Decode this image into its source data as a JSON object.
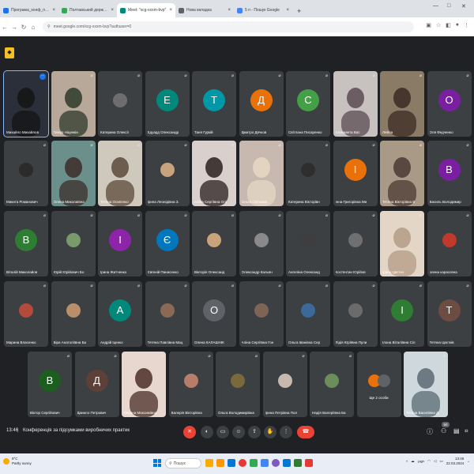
{
  "browser": {
    "tabs": [
      {
        "label": "Програма_конф_практ_2024.d",
        "fav": "#1a73e8",
        "active": false
      },
      {
        "label": "Полтавський державний агр",
        "fav": "#34a853",
        "active": false
      },
      {
        "label": "Meet: \"xcg-xxxm-bvp\"",
        "fav": "#00897b",
        "active": true
      },
      {
        "label": "Нова вкладка",
        "fav": "#5f6368",
        "active": false
      },
      {
        "label": "5 п - Пошук Google",
        "fav": "#4285f4",
        "active": false
      }
    ],
    "new_tab": "+",
    "url": "meet.google.com/xcg-xxxm-bvp?authuser=0"
  },
  "meet": {
    "participants": [
      {
        "name": "Михайло Михайлов",
        "kind": "video",
        "bg": "#2a2f3a",
        "fg": "#141414"
      },
      {
        "name": "Тимур Ніценкін",
        "kind": "video",
        "bg": "#b7a89a",
        "fg": "#2e3a2c"
      },
      {
        "name": "Катерина Олексії",
        "kind": "photo",
        "bg": "#3c4043",
        "fg": "#6d6d6d"
      },
      {
        "name": "Едуард Олександр",
        "kind": "letter",
        "letter": "Е",
        "color": "#00897b"
      },
      {
        "name": "Таня Гуркій",
        "kind": "letter",
        "letter": "Т",
        "color": "#0097a7"
      },
      {
        "name": "Дмитро Дячков",
        "kind": "letter",
        "letter": "Д",
        "color": "#e8710a"
      },
      {
        "name": "Світлана Писаренко",
        "kind": "letter",
        "letter": "С",
        "color": "#43a047"
      },
      {
        "name": "Єлизавета Вас",
        "kind": "video",
        "bg": "#c7c2c0",
        "fg": "#5a4b52"
      },
      {
        "name": "Лейла",
        "kind": "video",
        "bg": "#8a7b66",
        "fg": "#3a2a24"
      },
      {
        "name": "Оля Федченко",
        "kind": "letter",
        "letter": "О",
        "color": "#7b1fa2"
      },
      {
        "name": "Микита Романович",
        "kind": "photo",
        "bg": "#3c4043",
        "fg": "#2b2b2b"
      },
      {
        "name": "Олена Миколаївна",
        "kind": "video",
        "bg": "#6b8f8a",
        "fg": "#3b2d29"
      },
      {
        "name": "Тетяна Осипенко",
        "kind": "video",
        "bg": "#cfc8bd",
        "fg": "#5c4a3b"
      },
      {
        "name": "Ірина Леонідівна З.",
        "kind": "photo",
        "bg": "#3c4043",
        "fg": "#c9a27e"
      },
      {
        "name": "Аліна Сергіївна Олі",
        "kind": "video",
        "bg": "#d9d0cd",
        "fg": "#2a1f1f"
      },
      {
        "name": "Ольга Світлана",
        "kind": "video",
        "bg": "#c8b9b0",
        "fg": "#e6d8c4"
      },
      {
        "name": "Катерина Вікторівн",
        "kind": "photo",
        "bg": "#3c4043",
        "fg": "#2e2e2e"
      },
      {
        "name": "Інна Григорівна Ми",
        "kind": "letter",
        "letter": "І",
        "color": "#e8710a"
      },
      {
        "name": "Тетяна Вікторівна В",
        "kind": "video",
        "bg": "#a89a86",
        "fg": "#4b3a33"
      },
      {
        "name": "Василь Володимир",
        "kind": "letter",
        "letter": "В",
        "color": "#7b1fa2"
      },
      {
        "name": "Віталій Миколайов",
        "kind": "letter",
        "letter": "В",
        "color": "#2e7d32"
      },
      {
        "name": "Юрій Юрійович Бо",
        "kind": "photo",
        "bg": "#3c4043",
        "fg": "#7a9a6b"
      },
      {
        "name": "Ірина Житченко",
        "kind": "letter",
        "letter": "І",
        "color": "#8e24aa"
      },
      {
        "name": "Євгеній Панасенко",
        "kind": "letter",
        "letter": "Є",
        "color": "#0277bd"
      },
      {
        "name": "Вікторія Олександ",
        "kind": "photo",
        "bg": "#3c4043",
        "fg": "#caa27b"
      },
      {
        "name": "Олександр Кальян",
        "kind": "photo",
        "bg": "#3c4043",
        "fg": "#8a8a8a"
      },
      {
        "name": "Ангеліна Олександ",
        "kind": "photo",
        "bg": "#3c4043",
        "fg": "#3e3e3e"
      },
      {
        "name": "Костянтин Юрійов",
        "kind": "photo",
        "bg": "#3c4043",
        "fg": "#6f6f6f"
      },
      {
        "name": "Ірина Цвєтко",
        "kind": "video",
        "bg": "#e3d6c6",
        "fg": "#b49b86"
      },
      {
        "name": "олена карасєвна",
        "kind": "photo",
        "bg": "#3c4043",
        "fg": "#c0392b"
      },
      {
        "name": "Марина Власенко",
        "kind": "photo",
        "bg": "#3c4043",
        "fg": "#b34a3c"
      },
      {
        "name": "Віра Анатоліївна Ба",
        "kind": "photo",
        "bg": "#3c4043",
        "fg": "#b88e6b"
      },
      {
        "name": "Андрій Іценко",
        "kind": "letter",
        "letter": "А",
        "color": "#00897b"
      },
      {
        "name": "Тетяна Павлівна Мац",
        "kind": "photo",
        "bg": "#3c4043",
        "fg": "#8b6a55"
      },
      {
        "name": "Олена КАЛАШНІК",
        "kind": "letter",
        "letter": "О",
        "color": "#5f6368"
      },
      {
        "name": "Аліна Сергіївна Гон",
        "kind": "photo",
        "bg": "#3c4043",
        "fg": "#7d6457"
      },
      {
        "name": "Ольга Іванівна Сер",
        "kind": "photo",
        "bg": "#3c4043",
        "fg": "#3b6a9a"
      },
      {
        "name": "Лідія Юріївна Пули",
        "kind": "photo",
        "bg": "#3c4043",
        "fg": "#6b6b6b"
      },
      {
        "name": "Ілона Віталіївна Сіл",
        "kind": "letter",
        "letter": "І",
        "color": "#2e7d32"
      },
      {
        "name": "Тетяна Цвєтків",
        "kind": "letter",
        "letter": "Т",
        "color": "#6d4c41"
      },
      {
        "name": "Віктор Сергійович",
        "kind": "letter",
        "letter": "В",
        "color": "#1b5e20"
      },
      {
        "name": "Данило Петрович",
        "kind": "letter",
        "letter": "Д",
        "color": "#5d4037"
      },
      {
        "name": "Оксана Максимівна",
        "kind": "video",
        "bg": "#e8d7cf",
        "fg": "#4a2f28"
      },
      {
        "name": "Валерія Вікторівна",
        "kind": "photo",
        "bg": "#3c4043",
        "fg": "#b87c6a"
      },
      {
        "name": "Ольга Володимирівна",
        "kind": "photo",
        "bg": "#3c4043",
        "fg": "#7a6a3b"
      },
      {
        "name": "Ірина Петрівна Пол",
        "kind": "photo",
        "bg": "#3c4043",
        "fg": "#c7b9ad"
      },
      {
        "name": "Надія Валеріївна Ба",
        "kind": "photo",
        "bg": "#3c4043",
        "fg": "#6b8e5a"
      },
      {
        "name": "Ще 2 особи",
        "kind": "more",
        "color": "#e8710a"
      },
      {
        "name": "Тетяна Василівна Д",
        "kind": "video",
        "bg": "#cfd8dc",
        "fg": "#5a6b73"
      }
    ],
    "time": "13:46",
    "separator": "|",
    "title": "Конференція за підсумками виробничих практик",
    "participant_count": "50"
  },
  "taskbar": {
    "temp": "9°C",
    "weather": "Partly sunny",
    "search": "Пошук",
    "lang": "УКР",
    "time": "13:46",
    "date": "22.03.2024",
    "apps": [
      "#f9ab00",
      "#ff9800",
      "#0078d4",
      "#e53935",
      "#34a853",
      "#4285f4",
      "#7e57c2",
      "#0078d4",
      "#2e7d32",
      "#e53935"
    ]
  }
}
